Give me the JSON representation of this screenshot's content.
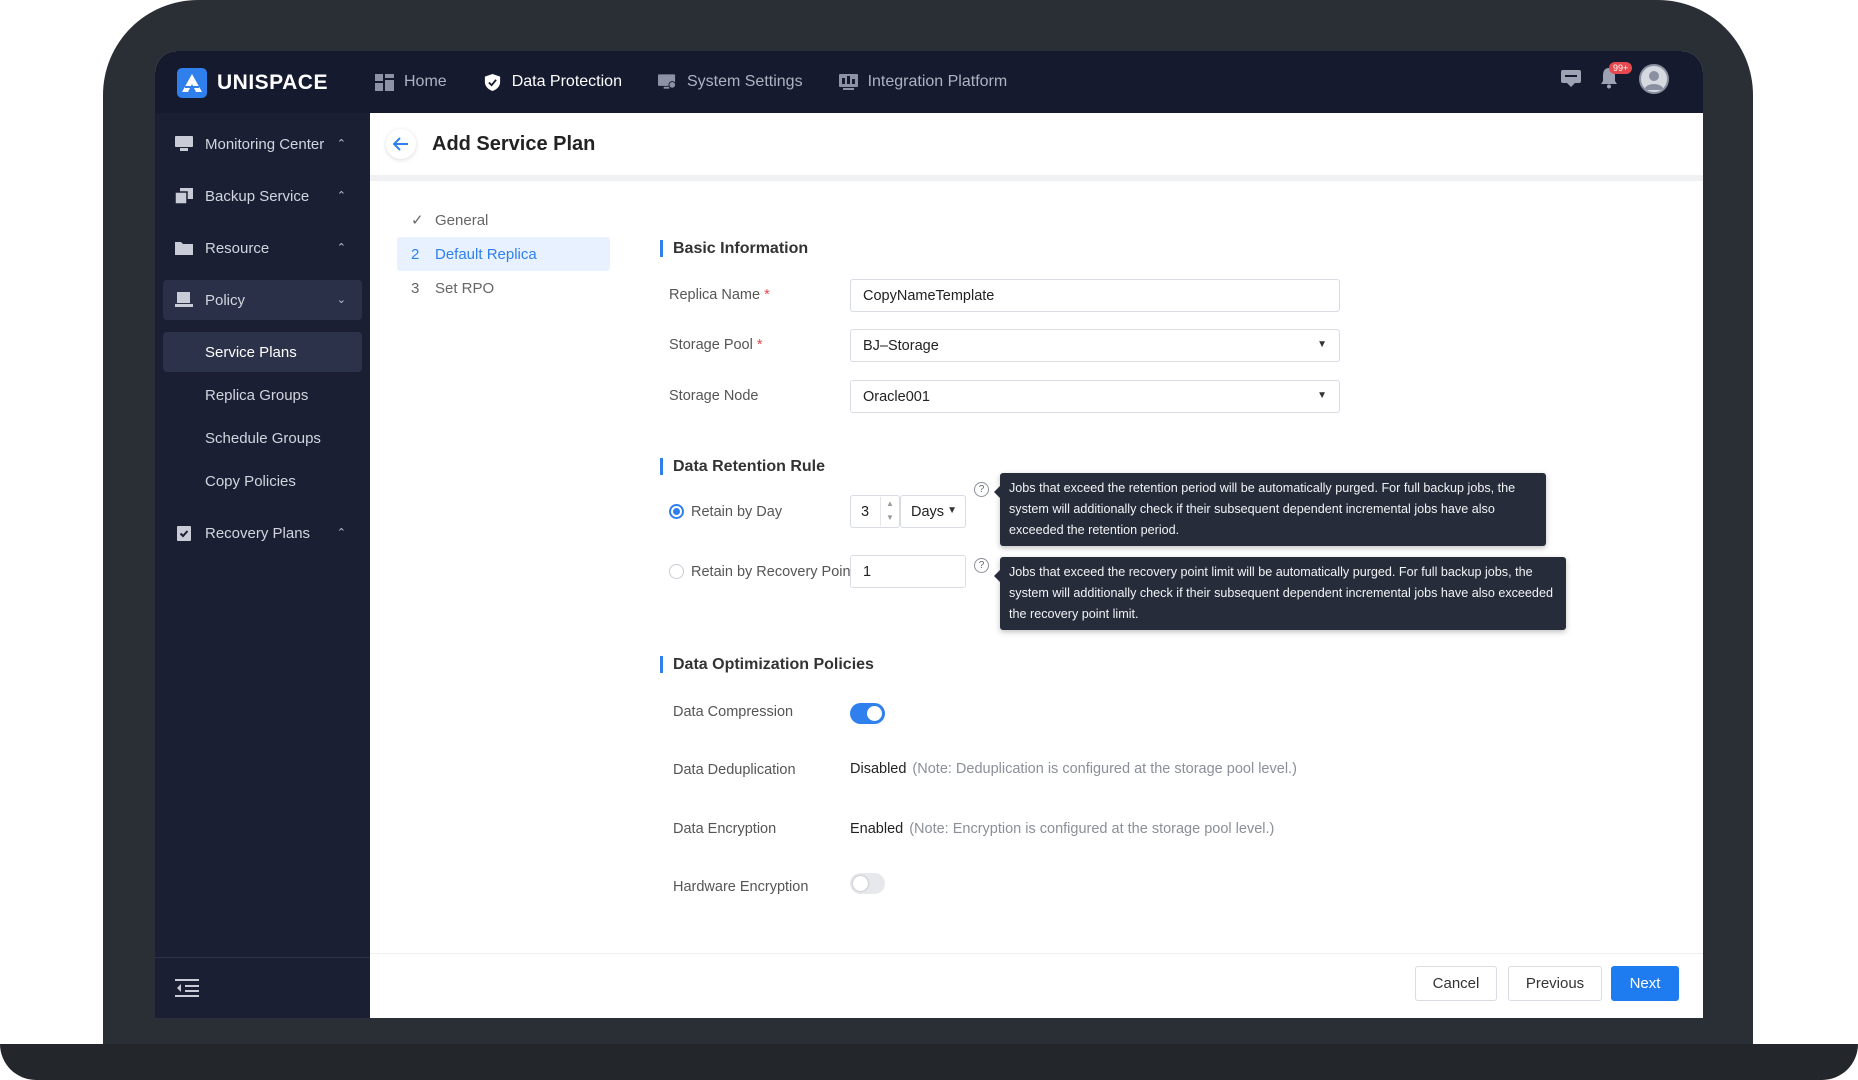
{
  "app": {
    "name": "UNISPACE"
  },
  "topnav": [
    {
      "label": "Home",
      "icon": "dashboard-icon"
    },
    {
      "label": "Data Protection",
      "icon": "shield-icon"
    },
    {
      "label": "System Settings",
      "icon": "monitor-gear-icon"
    },
    {
      "label": "Integration Platform",
      "icon": "integration-icon"
    }
  ],
  "notifications": {
    "badge": "99+"
  },
  "sidebar": {
    "items": [
      {
        "label": "Monitoring Center",
        "icon": "monitor-icon"
      },
      {
        "label": "Backup Service",
        "icon": "copy-icon"
      },
      {
        "label": "Resource",
        "icon": "folder-icon"
      },
      {
        "label": "Policy",
        "icon": "policy-icon"
      },
      {
        "label": "Recovery Plans",
        "icon": "clipboard-check-icon"
      }
    ],
    "policy_sub": [
      {
        "label": "Service Plans"
      },
      {
        "label": "Replica Groups"
      },
      {
        "label": "Schedule Groups"
      },
      {
        "label": "Copy Policies"
      }
    ]
  },
  "page": {
    "title": "Add Service Plan"
  },
  "steps": [
    {
      "num": "✓",
      "label": "General"
    },
    {
      "num": "2",
      "label": "Default Replica"
    },
    {
      "num": "3",
      "label": "Set RPO"
    }
  ],
  "basic": {
    "title": "Basic Information",
    "replica_name_label": "Replica Name",
    "replica_name_value": "CopyNameTemplate",
    "storage_pool_label": "Storage Pool",
    "storage_pool_value": "BJ–Storage",
    "storage_node_label": "Storage Node",
    "storage_node_value": "Oracle001",
    "required_mark": "*"
  },
  "retention": {
    "title": "Data Retention Rule",
    "by_day_label": "Retain by Day",
    "by_day_value": "3",
    "by_day_unit": "Days",
    "by_points_label": "Retain by Recovery Points",
    "by_points_value": "1",
    "help_mark": "?",
    "tip_day": "Jobs that exceed the retention period will be automatically purged. For full backup jobs, the system will additionally check if their subsequent dependent incremental jobs have also exceeded the retention period.",
    "tip_points": "Jobs that exceed the recovery point limit will be automatically purged. For full backup jobs, the system will additionally check if their subsequent dependent incremental jobs have also exceeded the recovery point limit."
  },
  "optimization": {
    "title": "Data Optimization Policies",
    "compression_label": "Data Compression",
    "compression_on": true,
    "dedup_label": "Data Deduplication",
    "dedup_value": "Disabled",
    "dedup_note": "(Note: Deduplication is configured at the storage pool level.)",
    "encryption_label": "Data Encryption",
    "encryption_value": "Enabled",
    "encryption_note": "(Note: Encryption is configured at the storage pool level.)",
    "hw_encryption_label": "Hardware Encryption",
    "hw_encryption_on": false
  },
  "footer": {
    "cancel": "Cancel",
    "previous": "Previous",
    "next": "Next"
  },
  "colors": {
    "accent": "#1f7cf0",
    "sidebar": "#1a1f33",
    "topbar": "#151a2e"
  }
}
